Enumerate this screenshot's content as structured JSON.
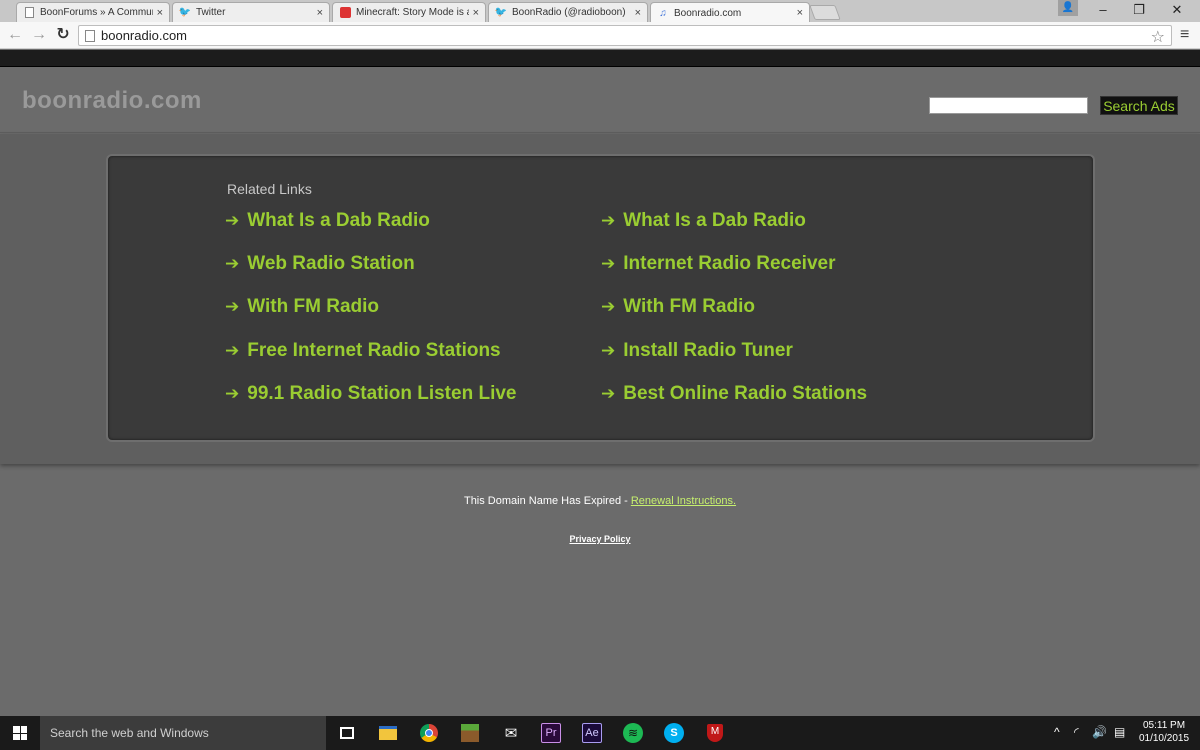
{
  "browser": {
    "tabs": [
      {
        "label": "BoonForums » A Commun",
        "icon": "page-icon"
      },
      {
        "label": "Twitter",
        "icon": "twitter-icon"
      },
      {
        "label": "Minecraft: Story Mode is a",
        "icon": "minecraft-icon"
      },
      {
        "label": "BoonRadio (@radioboon)",
        "icon": "twitter-icon"
      },
      {
        "label": "Boonradio.com",
        "icon": "music-note-icon"
      }
    ],
    "close_glyph": "×",
    "address": "boonradio.com",
    "window_controls": {
      "minimize": "–",
      "restore": "❐",
      "close": "✕"
    }
  },
  "site": {
    "title": "boonradio.com",
    "search_button": "Search Ads",
    "search_value": "",
    "related_heading": "Related Links",
    "arrow": "➔",
    "links_left": [
      "What Is a Dab Radio",
      "Web Radio Station",
      "With FM Radio",
      "Free Internet Radio Stations",
      "99.1 Radio Station Listen Live"
    ],
    "links_right": [
      "What Is a Dab Radio",
      "Internet Radio Receiver",
      "With FM Radio",
      "Install Radio Tuner",
      "Best Online Radio Stations"
    ],
    "expired_text": "This Domain Name Has Expired - ",
    "renewal_link": "Renewal Instructions.",
    "privacy": "Privacy Policy"
  },
  "taskbar": {
    "search_placeholder": "Search the web and Windows",
    "pinned": [
      "task-view-icon",
      "file-explorer-icon",
      "chrome-icon",
      "minecraft-icon",
      "mail-icon",
      "premiere-icon",
      "after-effects-icon",
      "spotify-icon",
      "skype-icon",
      "mcafee-icon"
    ],
    "premiere_label": "Pr",
    "ae_label": "Ae",
    "time": "05:11 PM",
    "date": "01/10/2015"
  },
  "colors": {
    "link": "#9acd32",
    "box": "#3a3a3a",
    "band": "#5f5f5f",
    "page": "#6b6b6b"
  }
}
